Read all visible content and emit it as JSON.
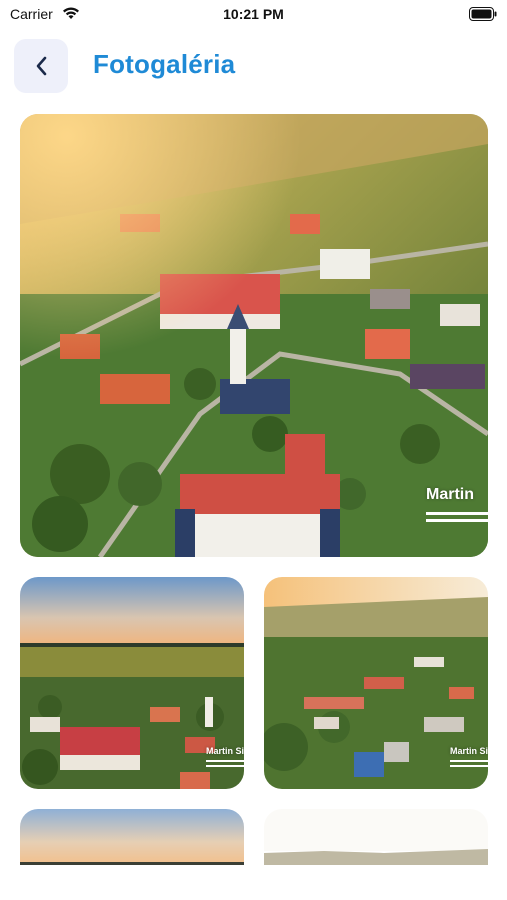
{
  "status_bar": {
    "carrier": "Carrier",
    "time": "10:21 PM"
  },
  "header": {
    "title": "Fotogaléria",
    "back_icon": "chevron-left-icon"
  },
  "gallery": {
    "photos": [
      {
        "watermark": "Martin",
        "alt": "Aerial view of village with church"
      },
      {
        "watermark": "Martin Si",
        "alt": "Village panorama at sunset"
      },
      {
        "watermark": "Martin Si",
        "alt": "Aerial village view with hills"
      },
      {
        "watermark": "",
        "alt": "Evening sky over village"
      },
      {
        "watermark": "",
        "alt": "Hazy landscape"
      }
    ]
  },
  "colors": {
    "accent": "#1f8ad6",
    "back_button_bg": "#eef0fa"
  }
}
